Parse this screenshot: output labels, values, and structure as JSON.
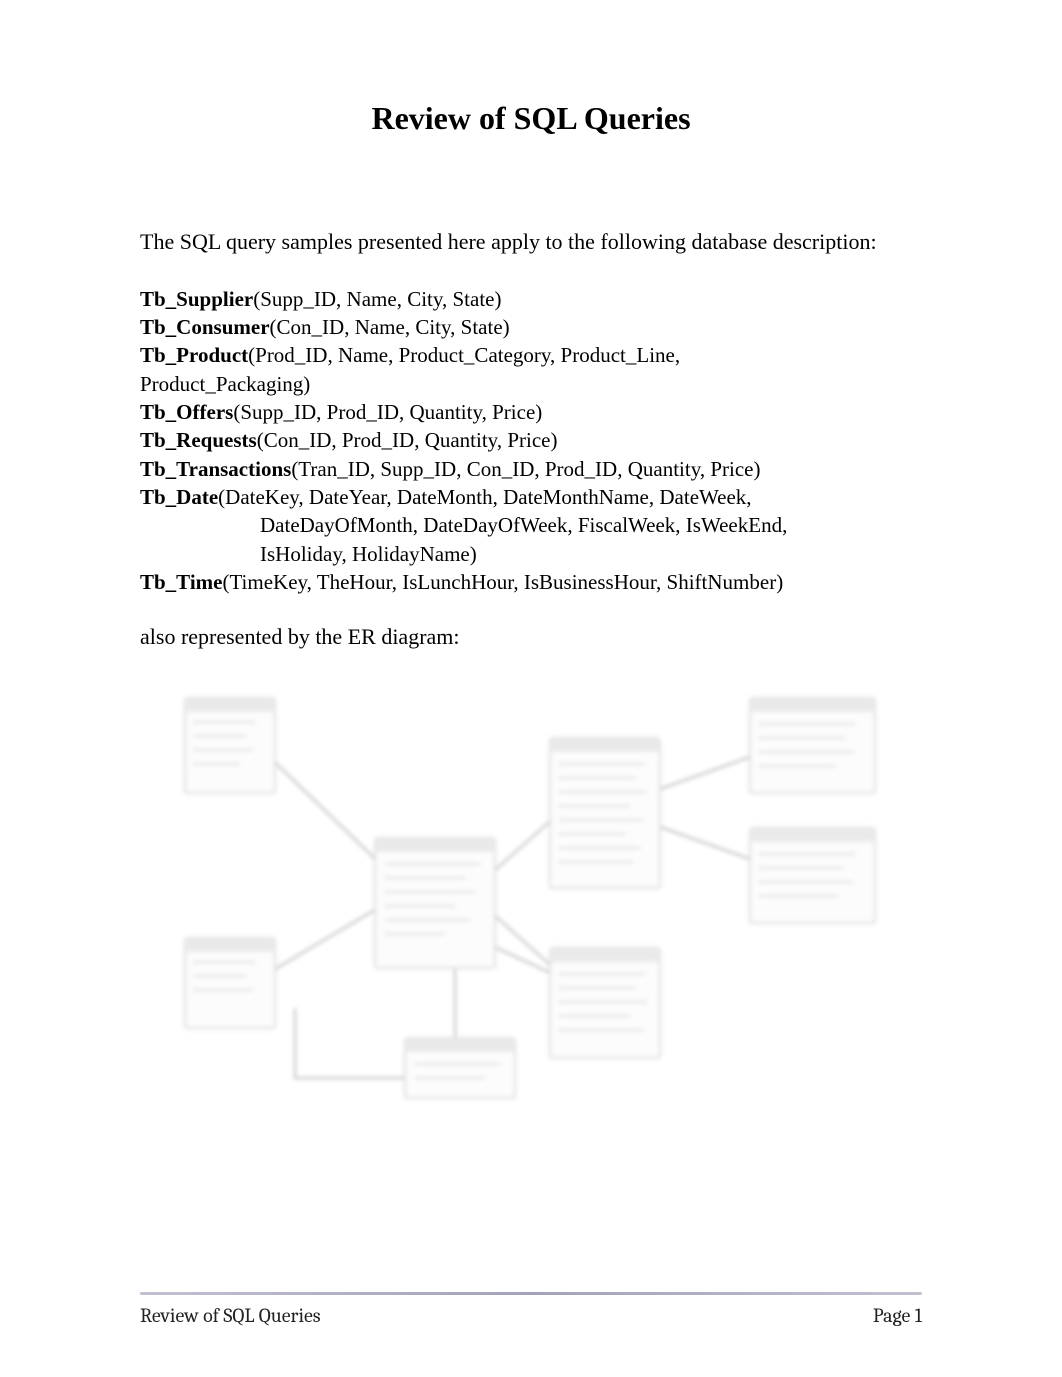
{
  "title": "Review of SQL Queries",
  "intro": "The SQL query samples presented here apply to the following database description:",
  "tables": [
    {
      "name": "Tb_Supplier",
      "fields": "(Supp_ID, Name, City, State)"
    },
    {
      "name": "Tb_Consumer",
      "fields": "(Con_ID, Name, City, State)"
    },
    {
      "name": "Tb_Product",
      "fields": "(Prod_ID, Name, Product_Category, Product_Line, Product_Packaging)"
    },
    {
      "name": "Tb_Offers",
      "fields": "(Supp_ID, Prod_ID, Quantity, Price)"
    },
    {
      "name": "Tb_Requests",
      "fields": "(Con_ID, Prod_ID, Quantity, Price)"
    },
    {
      "name": "Tb_Transactions",
      "fields": "(Tran_ID, Supp_ID, Con_ID, Prod_ID, Quantity, Price)"
    },
    {
      "name": "Tb_Date",
      "fields": "(DateKey, DateYear, DateMonth, DateMonthName, DateWeek, DateDayOfMonth, DateDayOfWeek, FiscalWeek, IsWeekEnd, IsHoliday, HolidayName)"
    },
    {
      "name": "Tb_Time",
      "fields": "(TimeKey, TheHour, IsLunchHour, IsBusinessHour, ShiftNumber)"
    }
  ],
  "product_wrap_tail": "Product_Packaging)",
  "date_cont1": "DateDayOfMonth, DateDayOfWeek, FiscalWeek, IsWeekEnd,",
  "date_cont2": "IsHoliday, HolidayName)",
  "also": "also represented by the ER diagram:",
  "footer_left": "Review of SQL Queries",
  "footer_page_label": "Page",
  "footer_page_num": "1"
}
